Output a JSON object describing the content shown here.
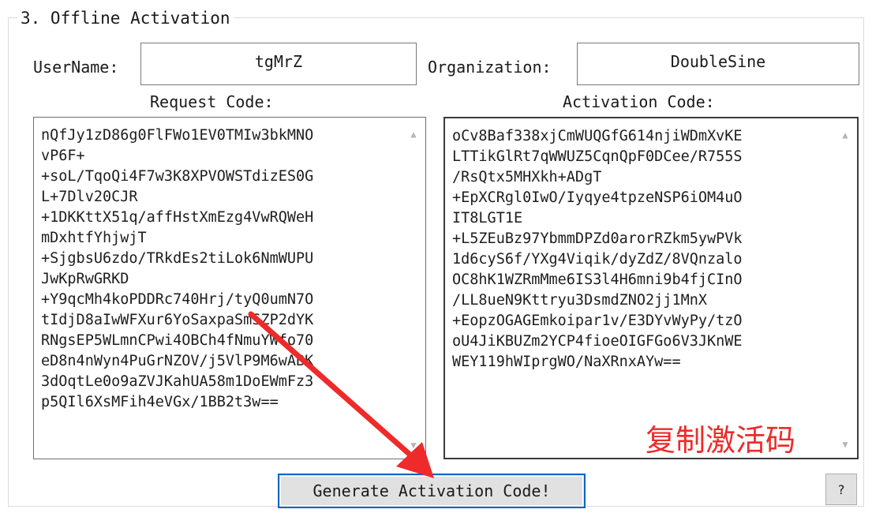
{
  "group": {
    "title": "3. Offline Activation"
  },
  "username": {
    "label": "UserName:",
    "value": "tgMrZ"
  },
  "organization": {
    "label": "Organization:",
    "value": "DoubleSine"
  },
  "request": {
    "label": "Request Code:",
    "code": "nQfJy1zD86g0FlFWo1EV0TMIw3bkMNO\nvP6F+\n+soL/TqoQi4F7w3K8XPVOWSTdizES0G\nL+7Dlv20CJR\n+1DKKttX51q/affHstXmEzg4VwRQWeH\nmDxhtfYhjwjT\n+SjgbsU6zdo/TRkdEs2tiLok6NmWUPU\nJwKpRwGRKD\n+Y9qcMh4koPDDRc740Hrj/tyQ0umN7O\ntIdjD8aIwWFXur6YoSaxpaSmSZP2dYK\nRNgsEP5WLmnCPwi4OBCh4fNmuYWfo70\neD8n4nWyn4PuGrNZOV/j5VlP9M6wABK\n3dOqtLe0o9aZVJKahUA58m1DoEWmFz3\np5QIl6XsMFih4eVGx/1BB2t3w=="
  },
  "activation": {
    "label": "Activation Code:",
    "code": "oCv8Baf338xjCmWUQGfG614njiWDmXvKE\nLTTikGlRt7qWWUZ5CqnQpF0DCee/R755S\n/RsQtx5MHXkh+ADgT\n+EpXCRgl0IwO/Iyqye4tpzeNSP6iOM4uO\nIT8LGT1E\n+L5ZEuBz97YbmmDPZd0arorRZkm5ywPVk\n1d6cyS6f/YXg4Viqik/dyZdZ/8VQnzalo\nOC8hK1WZRmMme6IS3l4H6mni9b4fjCInO\n/LL8ueN9Kttryu3DsmdZNO2jj1MnX\n+EopzOGAGEmkoipar1v/E3DYvWyPy/tzO\noU4JiKBUZm2YCP4fioeOIGFGo6V3JKnWE\nWEY119hWIprgWO/NaXRnxAYw=="
  },
  "annotation": {
    "text": "复制激活码",
    "color": "#ee2a2a"
  },
  "buttons": {
    "generate": "Generate Activation Code!",
    "help": "?"
  },
  "colors": {
    "focus_border": "#0a64c8",
    "arrow": "#ee2a2a"
  }
}
